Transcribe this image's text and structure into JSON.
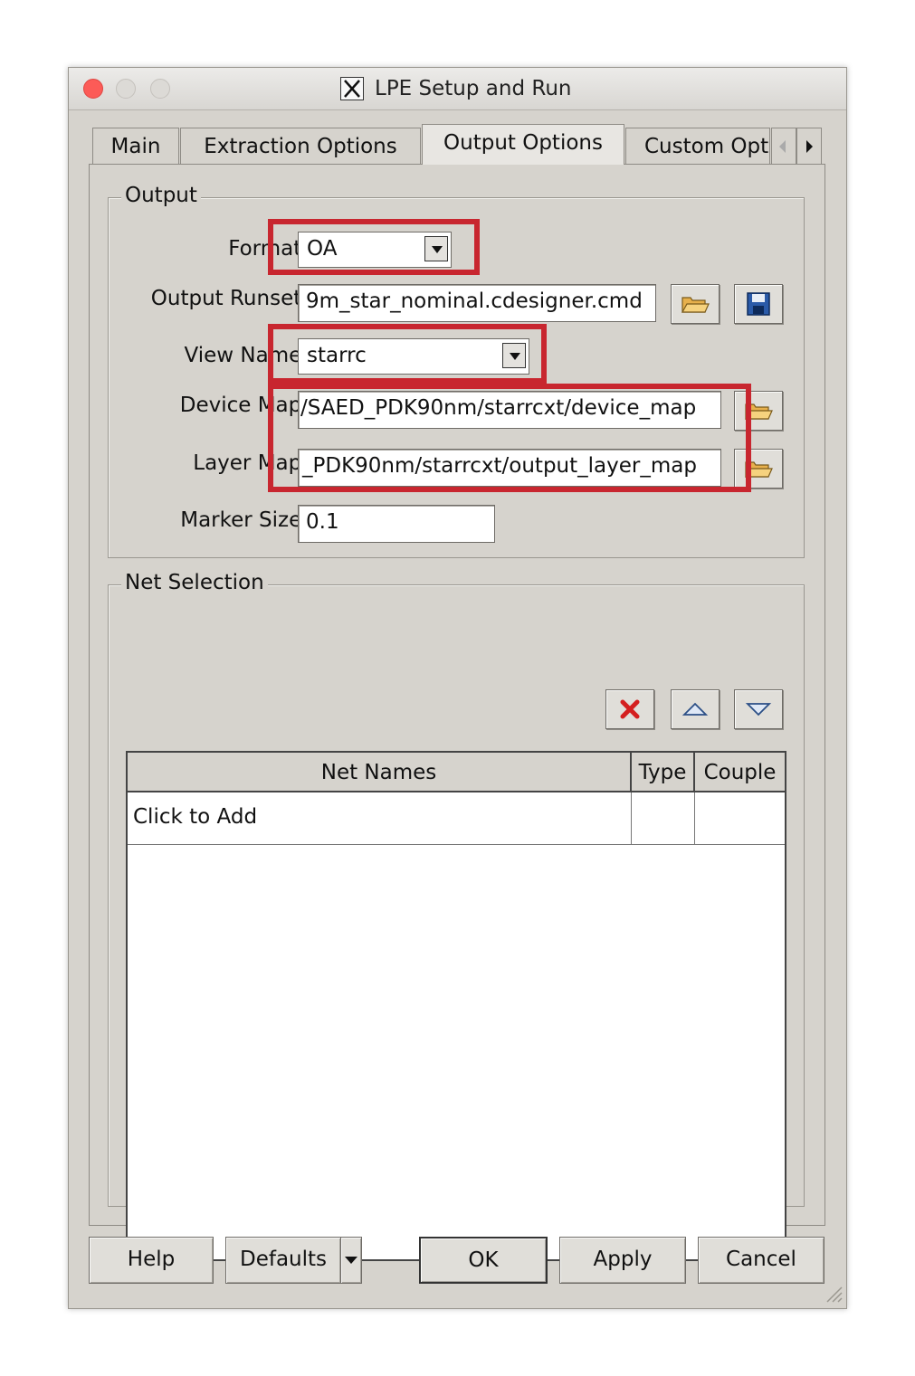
{
  "window": {
    "title": "LPE Setup and Run"
  },
  "tabs": [
    {
      "label": "Main"
    },
    {
      "label": "Extraction Options"
    },
    {
      "label": "Output Options"
    },
    {
      "label": "Custom Opt"
    }
  ],
  "output_group": {
    "legend": "Output",
    "format": {
      "label": "Format:",
      "value": "OA"
    },
    "output_runset": {
      "label": "Output Runset:",
      "value": "9m_star_nominal.cdesigner.cmd"
    },
    "view_name": {
      "label": "View Name:",
      "value": "starrc"
    },
    "device_map": {
      "label": "Device Map:",
      "value": "/SAED_PDK90nm/starrcxt/device_map"
    },
    "layer_map": {
      "label": "Layer Map:",
      "value": "_PDK90nm/starrcxt/output_layer_map"
    },
    "marker_size": {
      "label": "Marker Size:",
      "value": "0.1"
    }
  },
  "net_selection": {
    "legend": "Net Selection",
    "columns": [
      "Net Names",
      "Type",
      "Couple"
    ],
    "rows": [
      [
        "Click to Add",
        "",
        ""
      ]
    ]
  },
  "buttons": {
    "help": "Help",
    "defaults": "Defaults",
    "ok": "OK",
    "apply": "Apply",
    "cancel": "Cancel"
  },
  "highlight_color": "#c8262f",
  "icons": [
    "folder-open-icon",
    "save-disk-icon",
    "delete-x-icon",
    "move-up-icon",
    "move-down-icon"
  ]
}
